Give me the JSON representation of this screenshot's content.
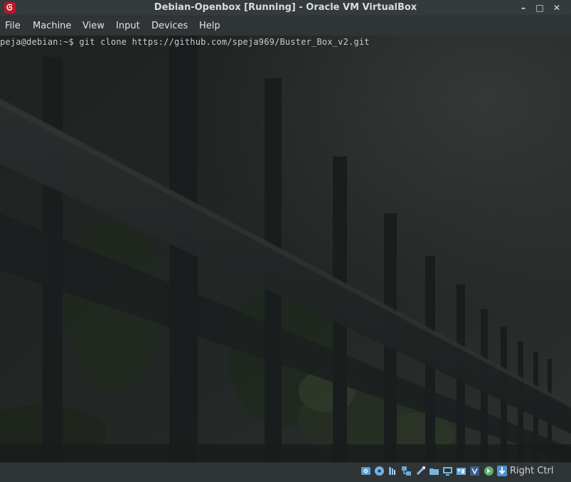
{
  "window": {
    "title": "Debian-Openbox [Running] - Oracle VM VirtualBox",
    "controls": {
      "minimize": "–",
      "maximize": "□",
      "close": "✕"
    }
  },
  "menu": {
    "items": [
      {
        "label": "File"
      },
      {
        "label": "Machine"
      },
      {
        "label": "View"
      },
      {
        "label": "Input"
      },
      {
        "label": "Devices"
      },
      {
        "label": "Help"
      }
    ]
  },
  "terminal": {
    "command_line": "peja@debian:~$ git clone https://github.com/speja969/Buster_Box_v2.git"
  },
  "statusbar": {
    "icons": [
      "hard-disk-icon",
      "optical-drive-icon",
      "audio-icon",
      "network-icon",
      "usb-icon",
      "shared-folders-icon",
      "display-icon",
      "video-capture-icon",
      "virtualization-icon",
      "mouse-integration-icon"
    ],
    "host_key_label": "Right Ctrl"
  },
  "colors": {
    "titlebar_bg": "#353a3c",
    "menubar_bg": "#2f3435",
    "debian_red": "#b7172a",
    "terminal_text": "#c9cbcc"
  }
}
